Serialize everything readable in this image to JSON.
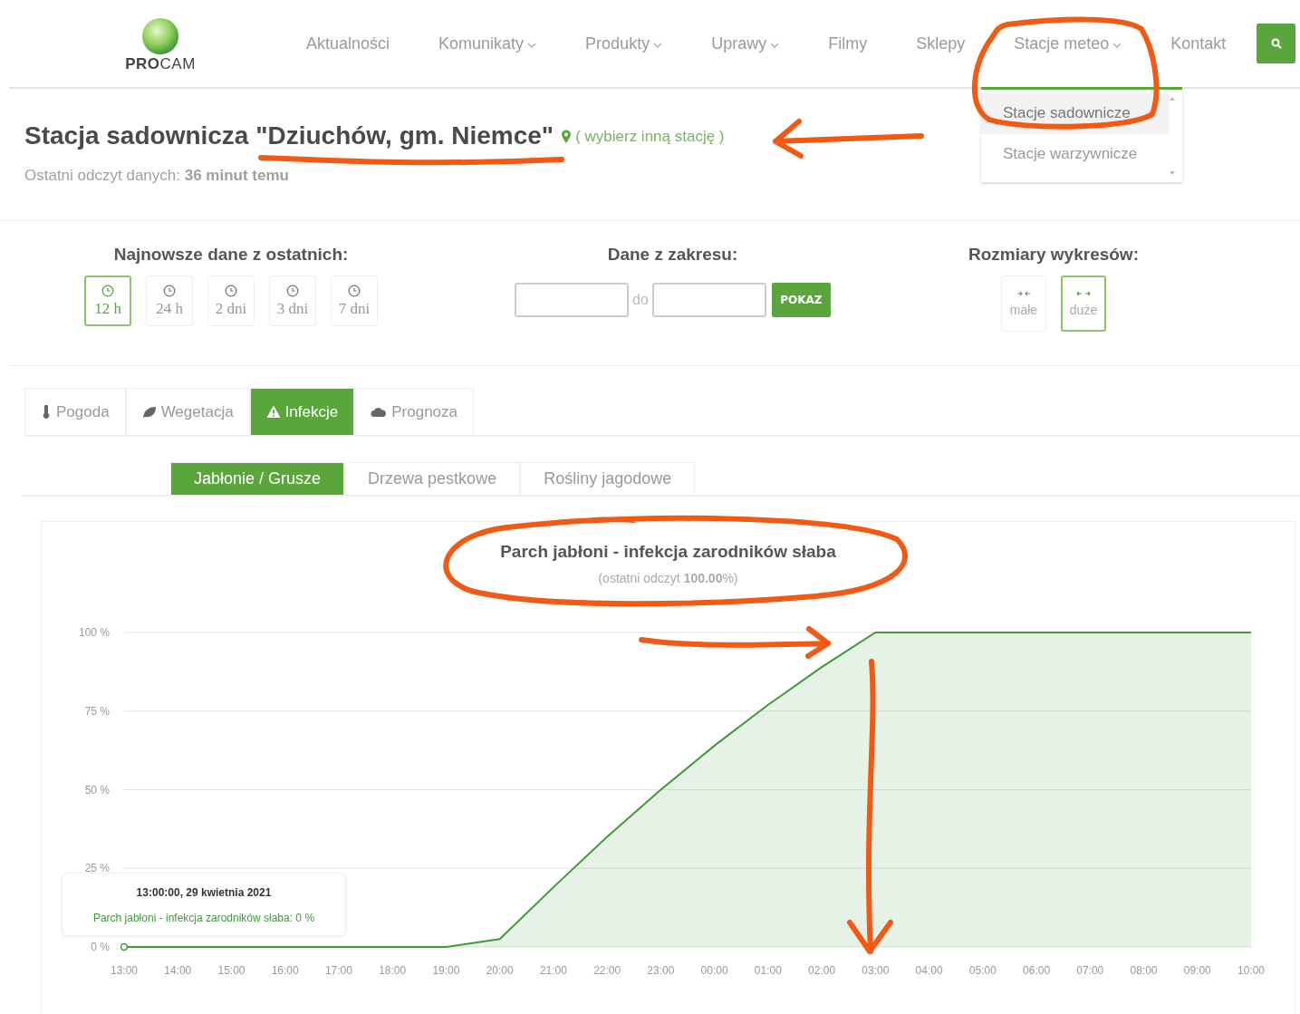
{
  "header": {
    "logo": "**PRO**CAM",
    "nav": [
      {
        "label": "Aktualności",
        "has_menu": false
      },
      {
        "label": "Komunikaty",
        "has_menu": true
      },
      {
        "label": "Produkty",
        "has_menu": true
      },
      {
        "label": "Uprawy",
        "has_menu": true
      },
      {
        "label": "Filmy",
        "has_menu": false
      },
      {
        "label": "Sklepy",
        "has_menu": false
      },
      {
        "label": "Stacje meteo",
        "has_menu": true
      },
      {
        "label": "Kontakt",
        "has_menu": false
      }
    ],
    "dropdown": [
      {
        "label": "Stacje sadownicze",
        "selected": true
      },
      {
        "label": "Stacje warzywnicze",
        "selected": false
      }
    ]
  },
  "station": {
    "title": "Stacja sadownicza \"Dziuchów, gm. Niemce\"",
    "change_link": "( wybierz inną stację )",
    "last_read": "Ostatni odczyt danych: **36 minut temu**"
  },
  "ranges": {
    "title": "Najnowsze dane z ostatnich:",
    "buttons": [
      {
        "label": "12 h",
        "selected": true
      },
      {
        "label": "24 h",
        "selected": false
      },
      {
        "label": "2 dni",
        "selected": false
      },
      {
        "label": "3 dni",
        "selected": false
      },
      {
        "label": "7 dni",
        "selected": false
      }
    ]
  },
  "date_range": {
    "title": "Dane z zakresu:",
    "separator": "do",
    "button": "POKAZ"
  },
  "sizes": {
    "title": "Rozmiary wykresów:",
    "buttons": [
      {
        "label": "małe",
        "selected": false
      },
      {
        "label": "duże",
        "selected": true
      }
    ]
  },
  "tabs": [
    {
      "label": "Pogoda",
      "selected": false
    },
    {
      "label": "Wegetacja",
      "selected": false
    },
    {
      "label": "Infekcje",
      "selected": true
    },
    {
      "label": "Prognoza",
      "selected": false
    }
  ],
  "subtabs": [
    {
      "label": "Jabłonie / Grusze",
      "selected": true
    },
    {
      "label": "Drzewa pestkowe",
      "selected": false
    },
    {
      "label": "Rośliny jagodowe",
      "selected": false
    }
  ],
  "chart": {
    "title": "Parch jabłoni - infekcja zarodników słaba",
    "subtitle": "(ostatni odczyt **100.00**%)",
    "chart_data": {
      "type": "area",
      "grid": true,
      "categories": [
        "13:00",
        "14:00",
        "15:00",
        "16:00",
        "17:00",
        "18:00",
        "19:00",
        "20:00",
        "21:00",
        "22:00",
        "23:00",
        "00:00",
        "01:00",
        "02:00",
        "03:00",
        "04:00",
        "05:00",
        "06:00",
        "07:00",
        "08:00",
        "09:00",
        "10:00"
      ],
      "series": [
        {
          "name": "Parch jabłoni - infekcja zarodników słaba",
          "color": "#3f9a3a",
          "values": [
            0,
            0,
            0,
            0,
            0,
            0,
            0,
            2.5,
            19,
            35,
            50,
            64,
            77,
            89,
            100,
            100,
            100,
            100,
            100,
            100,
            100,
            100
          ]
        }
      ],
      "ylim": [
        0,
        100
      ],
      "yticks": [
        {
          "value": 0,
          "label": "0 %"
        },
        {
          "value": 25,
          "label": "25 %"
        },
        {
          "value": 50,
          "label": "50 %"
        },
        {
          "value": 75,
          "label": "75 %"
        },
        {
          "value": 100,
          "label": "100 %"
        }
      ]
    },
    "tooltip": {
      "time": "13:00:00, 29 kwietnia 2021",
      "value": ": 0 %"
    }
  }
}
